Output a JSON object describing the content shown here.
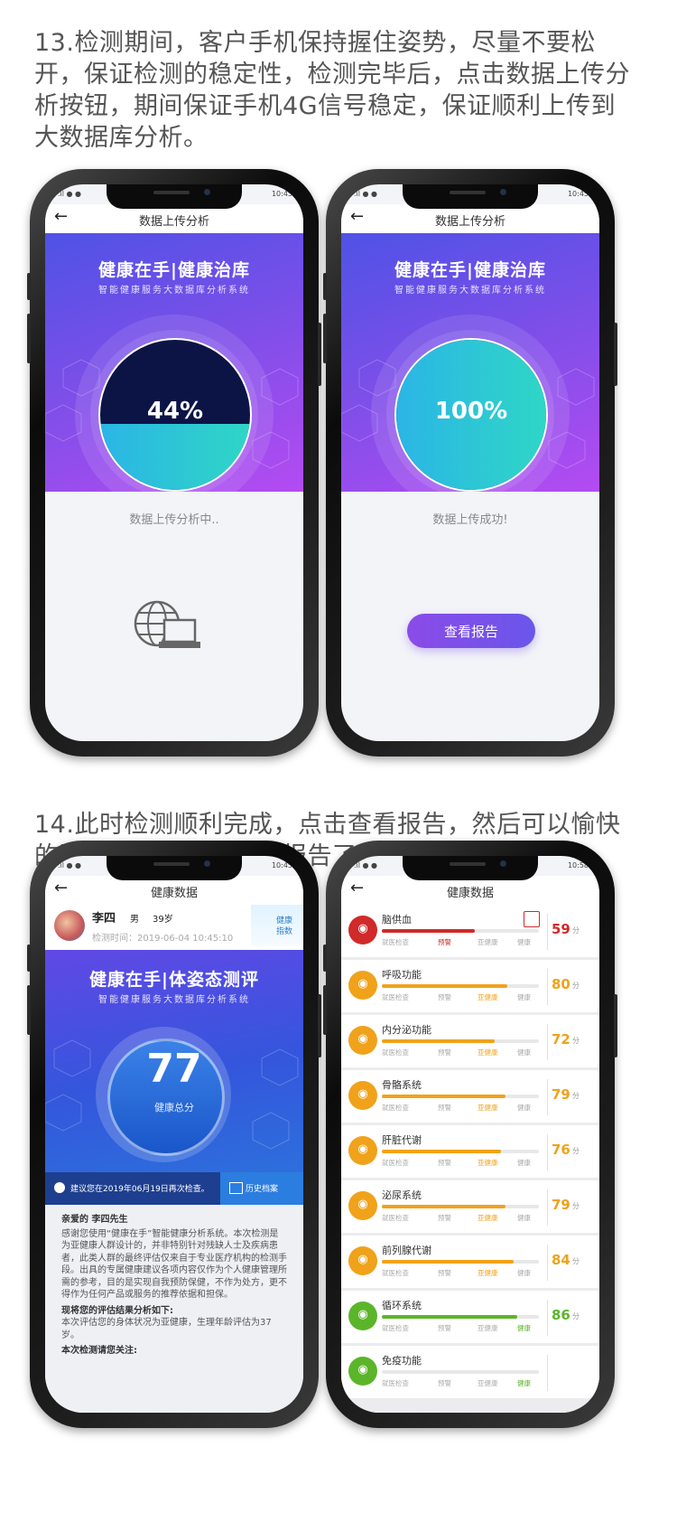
{
  "step13": {
    "text": "13.检测期间，客户手机保持握住姿势，尽量不要松开，保证检测的稳定性，检测完毕后，点击数据上传分析按钮，期间保证手机4G信号稳定，保证顺利上传到大数据库分析。"
  },
  "step14": {
    "text": "14.此时检测顺利完成，点击查看报告，然后可以愉快的跟客户一起探讨健康报告了！"
  },
  "status": {
    "time": "10:45",
    "time4": "10:58"
  },
  "upload": {
    "title": "数据上传分析",
    "brand": "健康在手|健康治库",
    "brand_sub": "智能健康服务大数据库分析系统",
    "progress_label": "44%",
    "progress_value": 44,
    "message": "数据上传分析中.."
  },
  "upload_done": {
    "title": "数据上传分析",
    "brand": "健康在手|健康治库",
    "brand_sub": "智能健康服务大数据库分析系统",
    "progress_label": "100%",
    "progress_value": 100,
    "message": "数据上传成功!",
    "button": "查看报告"
  },
  "health": {
    "title": "健康数据",
    "user": {
      "name": "李四",
      "gender": "男",
      "age": "39岁",
      "time": "检测时间：2019-06-04 10:45:10"
    },
    "index_badge": "健康指数",
    "brand": "健康在手|体姿态测评",
    "brand_sub": "智能健康服务大数据库分析系统",
    "score": "77",
    "score_label": "健康总分",
    "suggest": "建议您在2019年06月19日再次检查。",
    "history": "历史档案",
    "greet": "亲爱的 李四先生",
    "body1": "感谢您使用“健康在手”智能健康分析系统。本次检测是为亚健康人群设计的，并非特别针对残缺人士及疾病患者，此类人群的最终评估仅来自于专业医疗机构的检测手段。出具的专属健康建议各项内容仅作为个人健康管理所需的参考，目的是实现自我预防保健，不作为处方，更不得作为任何产品或服务的推荐依据和担保。",
    "sub1": "现将您的评估结果分析如下:",
    "body2": "本次评估您的身体状况为亚健康，生理年龄评估为37岁。",
    "sub2": "本次检测请您关注:"
  },
  "detail": {
    "title": "健康数据",
    "scale": [
      "就医检查",
      "预警",
      "亚健康",
      "健康"
    ],
    "unit": "分",
    "items": [
      {
        "name": "脑供血",
        "value": "59",
        "pct": 0.59,
        "color": "#d02a2a",
        "icon": "brain-icon",
        "state": 1
      },
      {
        "name": "呼吸功能",
        "value": "80",
        "pct": 0.8,
        "color": "#f0a21b",
        "icon": "lungs-icon",
        "state": 2
      },
      {
        "name": "内分泌功能",
        "value": "72",
        "pct": 0.72,
        "color": "#f0a21b",
        "icon": "gland-icon",
        "state": 2
      },
      {
        "name": "骨骼系统",
        "value": "79",
        "pct": 0.79,
        "color": "#f0a21b",
        "icon": "bone-icon",
        "state": 2
      },
      {
        "name": "肝脏代谢",
        "value": "76",
        "pct": 0.76,
        "color": "#f0a21b",
        "icon": "liver-icon",
        "state": 2
      },
      {
        "name": "泌尿系统",
        "value": "79",
        "pct": 0.79,
        "color": "#f0a21b",
        "icon": "kidney-icon",
        "state": 2
      },
      {
        "name": "前列腺代谢",
        "value": "84",
        "pct": 0.84,
        "color": "#f0a21b",
        "icon": "prostate-icon",
        "state": 2
      },
      {
        "name": "循环系统",
        "value": "86",
        "pct": 0.86,
        "color": "#5bb52a",
        "icon": "heart-icon",
        "state": 3
      },
      {
        "name": "免疫功能",
        "value": "",
        "pct": 0,
        "color": "#5bb52a",
        "icon": "immune-icon",
        "state": 3
      }
    ]
  }
}
